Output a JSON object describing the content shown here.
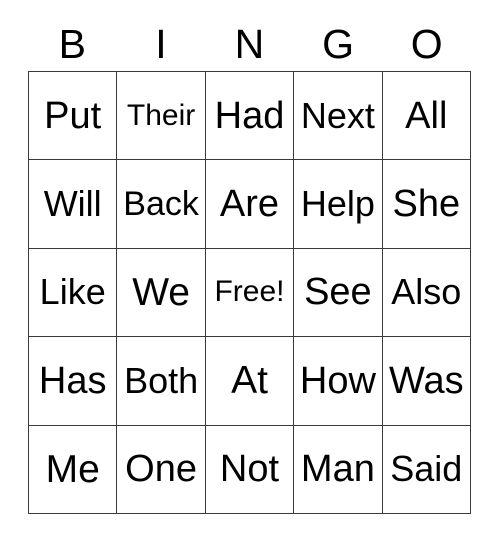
{
  "card": {
    "background_color": "#ffffff",
    "grid_line_color": "#3a3a3a",
    "text_color": "#000000"
  },
  "header": {
    "letters": [
      "B",
      "I",
      "N",
      "G",
      "O"
    ]
  },
  "grid": {
    "columns": 5,
    "rows": 5,
    "free_space": "Free!",
    "free_space_position": {
      "row": 2,
      "col": 2
    },
    "rows_data": [
      [
        "Put",
        "Their",
        "Had",
        "Next",
        "All"
      ],
      [
        "Will",
        "Back",
        "Are",
        "Help",
        "She"
      ],
      [
        "Like",
        "We",
        "Free!",
        "See",
        "Also"
      ],
      [
        "Has",
        "Both",
        "At",
        "How",
        "Was"
      ],
      [
        "Me",
        "One",
        "Not",
        "Man",
        "Said"
      ]
    ]
  }
}
